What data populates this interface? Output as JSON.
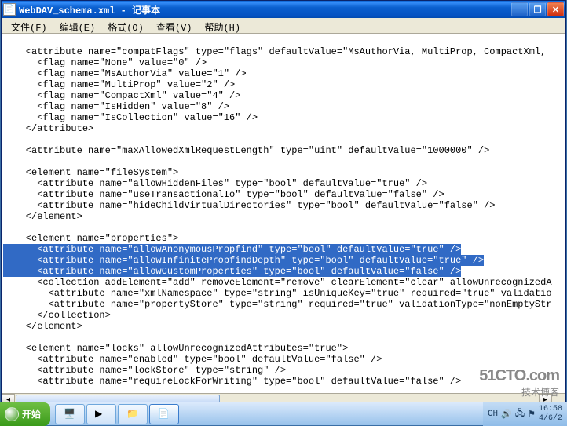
{
  "titlebar": {
    "filename": "WebDAV_schema.xml",
    "app": "记事本",
    "separator": " - "
  },
  "menubar": {
    "file": "文件(F)",
    "edit": "编辑(E)",
    "format": "格式(O)",
    "view": "查看(V)",
    "help": "帮助(H)"
  },
  "lines": [
    "",
    "    <attribute name=\"compatFlags\" type=\"flags\" defaultValue=\"MsAuthorVia, MultiProp, CompactXml, ",
    "      <flag name=\"None\" value=\"0\" />",
    "      <flag name=\"MsAuthorVia\" value=\"1\" />",
    "      <flag name=\"MultiProp\" value=\"2\" />",
    "      <flag name=\"CompactXml\" value=\"4\" />",
    "      <flag name=\"IsHidden\" value=\"8\" />",
    "      <flag name=\"IsCollection\" value=\"16\" />",
    "    </attribute>",
    "",
    "    <attribute name=\"maxAllowedXmlRequestLength\" type=\"uint\" defaultValue=\"1000000\" />",
    "",
    "    <element name=\"fileSystem\">",
    "      <attribute name=\"allowHiddenFiles\" type=\"bool\" defaultValue=\"true\" />",
    "      <attribute name=\"useTransactionalIo\" type=\"bool\" defaultValue=\"false\" />",
    "      <attribute name=\"hideChildVirtualDirectories\" type=\"bool\" defaultValue=\"false\" />",
    "    </element>",
    "",
    "    <element name=\"properties\">"
  ],
  "selected_lines": [
    "      <attribute name=\"allowAnonymousPropfind\" type=\"bool\" defaultValue=\"true\" />",
    "      <attribute name=\"allowInfinitePropfindDepth\" type=\"bool\" defaultValue=\"true\" />",
    "      <attribute name=\"allowCustomProperties\" type=\"bool\" defaultValue=\"false\" />"
  ],
  "lines_after": [
    "      <collection addElement=\"add\" removeElement=\"remove\" clearElement=\"clear\" allowUnrecognizedA",
    "        <attribute name=\"xmlNamespace\" type=\"string\" isUniqueKey=\"true\" required=\"true\" validatio",
    "        <attribute name=\"propertyStore\" type=\"string\" required=\"true\" validationType=\"nonEmptyStr",
    "      </collection>",
    "    </element>",
    "",
    "    <element name=\"locks\" allowUnrecognizedAttributes=\"true\">",
    "      <attribute name=\"enabled\" type=\"bool\" defaultValue=\"false\" />",
    "      <attribute name=\"lockStore\" type=\"string\" />",
    "      <attribute name=\"requireLockForWriting\" type=\"bool\" defaultValue=\"false\" />"
  ],
  "start": {
    "label": "开始"
  },
  "tray": {
    "ime": "CH",
    "time": "16:58",
    "date": "4/6/2"
  },
  "watermark": {
    "line1": "51CTO.com",
    "line2": "技术博客"
  }
}
